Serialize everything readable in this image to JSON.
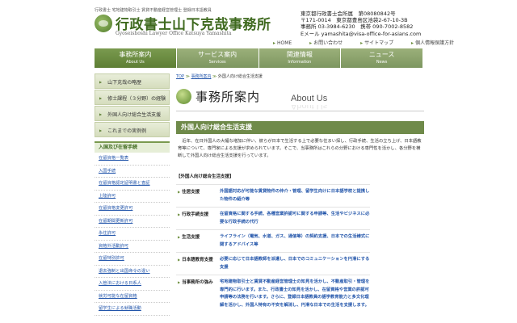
{
  "header": {
    "tagline": "行政書士 宅地建物取引士 賃貸不動産経営管理士 登録日本語教員",
    "title": "行政書士山下克哉事務所",
    "subtitle": "Gyoseishoshi Lawyer Office Katsuya Yamashita",
    "contact": [
      "東京都行政書士会所属　第08080842号",
      "〒171-0014　東京都豊島区池袋2-67-10-3B",
      "事務所 03-3984-6230　携帯 090-7002-8582",
      "Eメール yamashita@visa-office-for-asians.com"
    ],
    "toplinks": [
      "HOME",
      "お問い合わせ",
      "サイトマップ",
      "個人情報保護方針"
    ]
  },
  "nav": [
    {
      "jp": "事務所案内",
      "en": "About Us"
    },
    {
      "jp": "サービス案内",
      "en": "Services"
    },
    {
      "jp": "関連情報",
      "en": "Information"
    },
    {
      "jp": "ニュース",
      "en": "News"
    }
  ],
  "sidebar": {
    "buttons": [
      "山下克哉の略歴",
      "修士課程（３分野）の経験",
      "外国人向け総合生活支援",
      "これまでの実例例"
    ],
    "section_title": "入国及び在留手続",
    "links": [
      "在留資格一覧表",
      "入国手続",
      "在留資格認定証明書と査証",
      "上陸許可",
      "在留資格変更許可",
      "在留期間更新許可",
      "永住許可",
      "資格外活動許可",
      "在留特別許可",
      "退去強制と出国命令の違い",
      "入管法における日系人",
      "就労可能な在留資格",
      "留学生による就職活動"
    ]
  },
  "breadcrumb": {
    "home": "TOP",
    "parent": "事務所案内",
    "current": "外国人向け総合生活支援"
  },
  "page_heading": {
    "title": "事務所案内",
    "en": "About Us"
  },
  "section": {
    "title": "外国人向け総合生活支援",
    "intro": "近年、在日外国人の大幅な増加に伴い、彼らが日本で生活する上で必要な住まい探し、行政手続、生活の立ち上げ、日本語教育等について、専門家による支援が求められています。そこで、当事務所はこれらの分野における専門性を活かし、各分野を横断して外国人向け総合生活支援を行っています。",
    "subhead": "【外国人向け総合生活支援】",
    "rows": [
      {
        "label": "住居支援",
        "desc": "外国語対応が可能な賃貸物件の仲介・管理、留学生向けに日本語学校と提携した物件の紹介等"
      },
      {
        "label": "行政手続支援",
        "desc": "在留資格に関する手続、各種営業許認可に関する申請等、生活やビジネスに必要な行政手続の代行"
      },
      {
        "label": "生活支援",
        "desc": "ライフライン（電気、水道、ガス、通信等）の契約支援、日本での生活様式に関するアドバイス等"
      },
      {
        "label": "日本語教育支援",
        "desc": "必要に応じて日本語教師を派遣し、日本でのコミュニケーションを円滑にする支援"
      },
      {
        "label": "当事務所の強み",
        "desc": "宅地建物取引士と賃貸不動産経営管理士の知見を活かし、不動産取引・管理を専門的に行います。また、行政書士の知見を活かし、在留資格や営業の許認可申請等の法務を行います。さらに、登録日本語教員の語学教育能力と多文化理解を活かし、外国人特有の不安を解消し、円滑な日本での生活を支援します。"
      }
    ]
  }
}
